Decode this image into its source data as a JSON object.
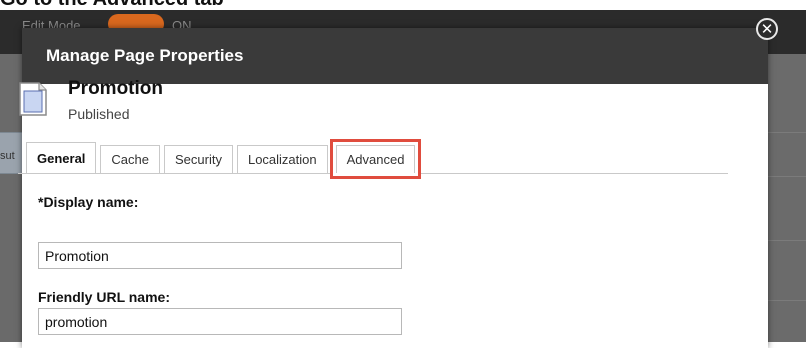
{
  "top_heading": "Go to the Advanced tab",
  "background": {
    "edit_mode_label": "Edit Mode",
    "toggle_state": "ON",
    "side_text": "sut"
  },
  "dialog": {
    "title": "Manage Page Properties",
    "close_icon": "close-icon"
  },
  "page": {
    "icon": "document-icon",
    "title": "Promotion",
    "status": "Published"
  },
  "tabs": [
    {
      "label": "General",
      "active": true
    },
    {
      "label": "Cache",
      "active": false
    },
    {
      "label": "Security",
      "active": false
    },
    {
      "label": "Localization",
      "active": false
    },
    {
      "label": "Advanced",
      "active": false,
      "highlighted": true
    }
  ],
  "form": {
    "display_name": {
      "label": "*Display name:",
      "value": "Promotion"
    },
    "friendly_url": {
      "label": "Friendly URL name:",
      "value": "promotion"
    }
  },
  "colors": {
    "highlight_outline": "#e04c3e",
    "header_bg": "#3a3a3a",
    "toggle_accent": "#d9681e"
  }
}
